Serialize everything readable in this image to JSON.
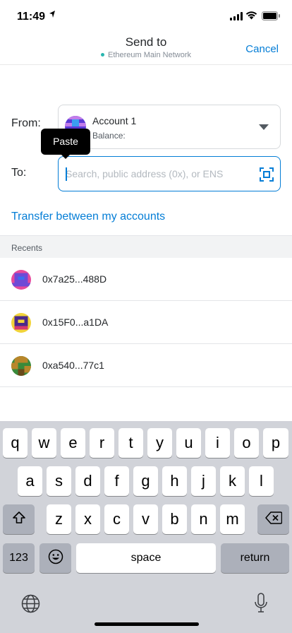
{
  "status_bar": {
    "time": "11:49"
  },
  "header": {
    "title": "Send to",
    "network": "Ethereum Main Network",
    "cancel_label": "Cancel"
  },
  "from": {
    "label": "From:",
    "account_name": "Account 1",
    "balance_label": "Balance:"
  },
  "tooltip": {
    "paste_label": "Paste"
  },
  "to": {
    "label": "To:",
    "placeholder": "Search, public address (0x), or ENS"
  },
  "transfer_link": "Transfer between my accounts",
  "recents": {
    "title": "Recents",
    "items": [
      {
        "address": "0x7a25...488D"
      },
      {
        "address": "0x15F0...a1DA"
      },
      {
        "address": "0xa540...77c1"
      }
    ]
  },
  "keyboard": {
    "row1": [
      "q",
      "w",
      "e",
      "r",
      "t",
      "y",
      "u",
      "i",
      "o",
      "p"
    ],
    "row2": [
      "a",
      "s",
      "d",
      "f",
      "g",
      "h",
      "j",
      "k",
      "l"
    ],
    "row3": [
      "z",
      "x",
      "c",
      "v",
      "b",
      "n",
      "m"
    ],
    "numbers_label": "123",
    "space_label": "space",
    "return_label": "return"
  },
  "colors": {
    "accent": "#037dd6",
    "network_dot": "#29b6af",
    "tooltip_bg": "#000000",
    "keyboard_bg": "#d1d3d9"
  },
  "icons": {
    "scan": "qr-scan-icon",
    "caret": "chevron-down-icon",
    "shift": "shift-icon",
    "backspace": "backspace-icon",
    "emoji": "emoji-icon",
    "globe": "globe-icon",
    "mic": "microphone-icon"
  }
}
